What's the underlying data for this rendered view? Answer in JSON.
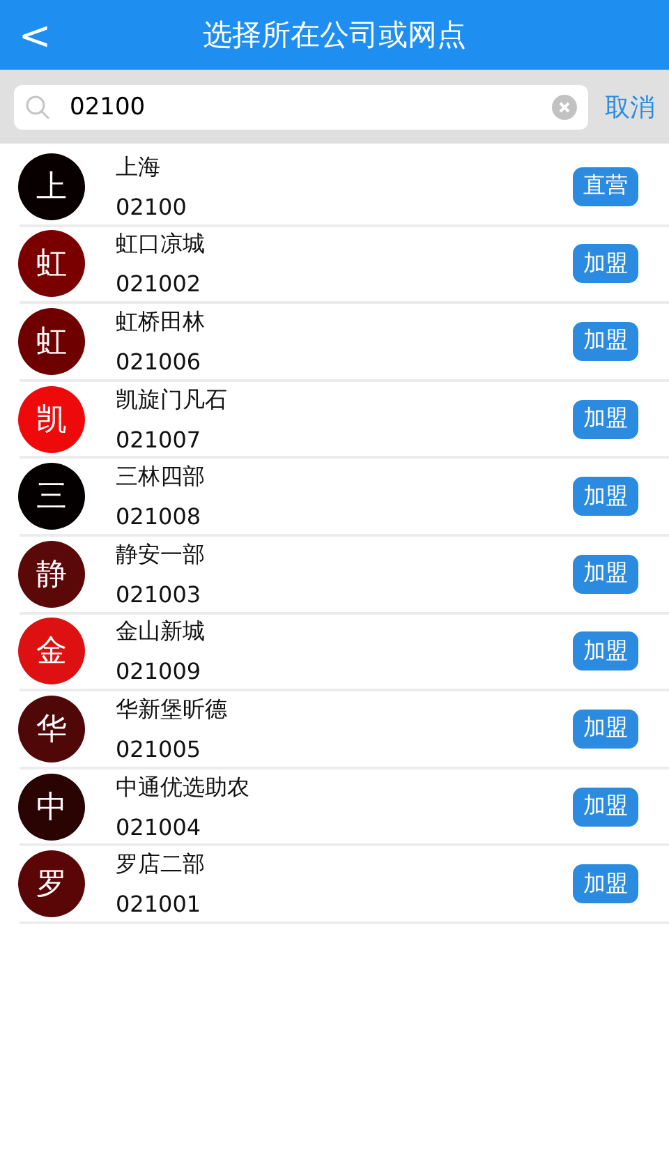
{
  "header": {
    "back": "<",
    "title": "选择所在公司或网点"
  },
  "search": {
    "value": "02100",
    "cancel": "取消"
  },
  "items": [
    {
      "avatar": "上",
      "color": "#080000",
      "name": "上海",
      "code": "02100",
      "badge": "直营"
    },
    {
      "avatar": "虹",
      "color": "#7a0000",
      "name": "虹口凉城",
      "code": "021002",
      "badge": "加盟"
    },
    {
      "avatar": "虹",
      "color": "#6e0000",
      "name": "虹桥田林",
      "code": "021006",
      "badge": "加盟"
    },
    {
      "avatar": "凯",
      "color": "#ee0a0a",
      "name": "凯旋门凡石",
      "code": "021007",
      "badge": "加盟"
    },
    {
      "avatar": "三",
      "color": "#050000",
      "name": "三林四部",
      "code": "021008",
      "badge": "加盟"
    },
    {
      "avatar": "静",
      "color": "#5a0808",
      "name": "静安一部",
      "code": "021003",
      "badge": "加盟"
    },
    {
      "avatar": "金",
      "color": "#dd1111",
      "name": "金山新城",
      "code": "021009",
      "badge": "加盟"
    },
    {
      "avatar": "华",
      "color": "#4f0707",
      "name": "华新堡昕德",
      "code": "021005",
      "badge": "加盟"
    },
    {
      "avatar": "中",
      "color": "#2a0303",
      "name": "中通优选助农",
      "code": "021004",
      "badge": "加盟"
    },
    {
      "avatar": "罗",
      "color": "#5a0606",
      "name": "罗店二部",
      "code": "021001",
      "badge": "加盟"
    }
  ]
}
